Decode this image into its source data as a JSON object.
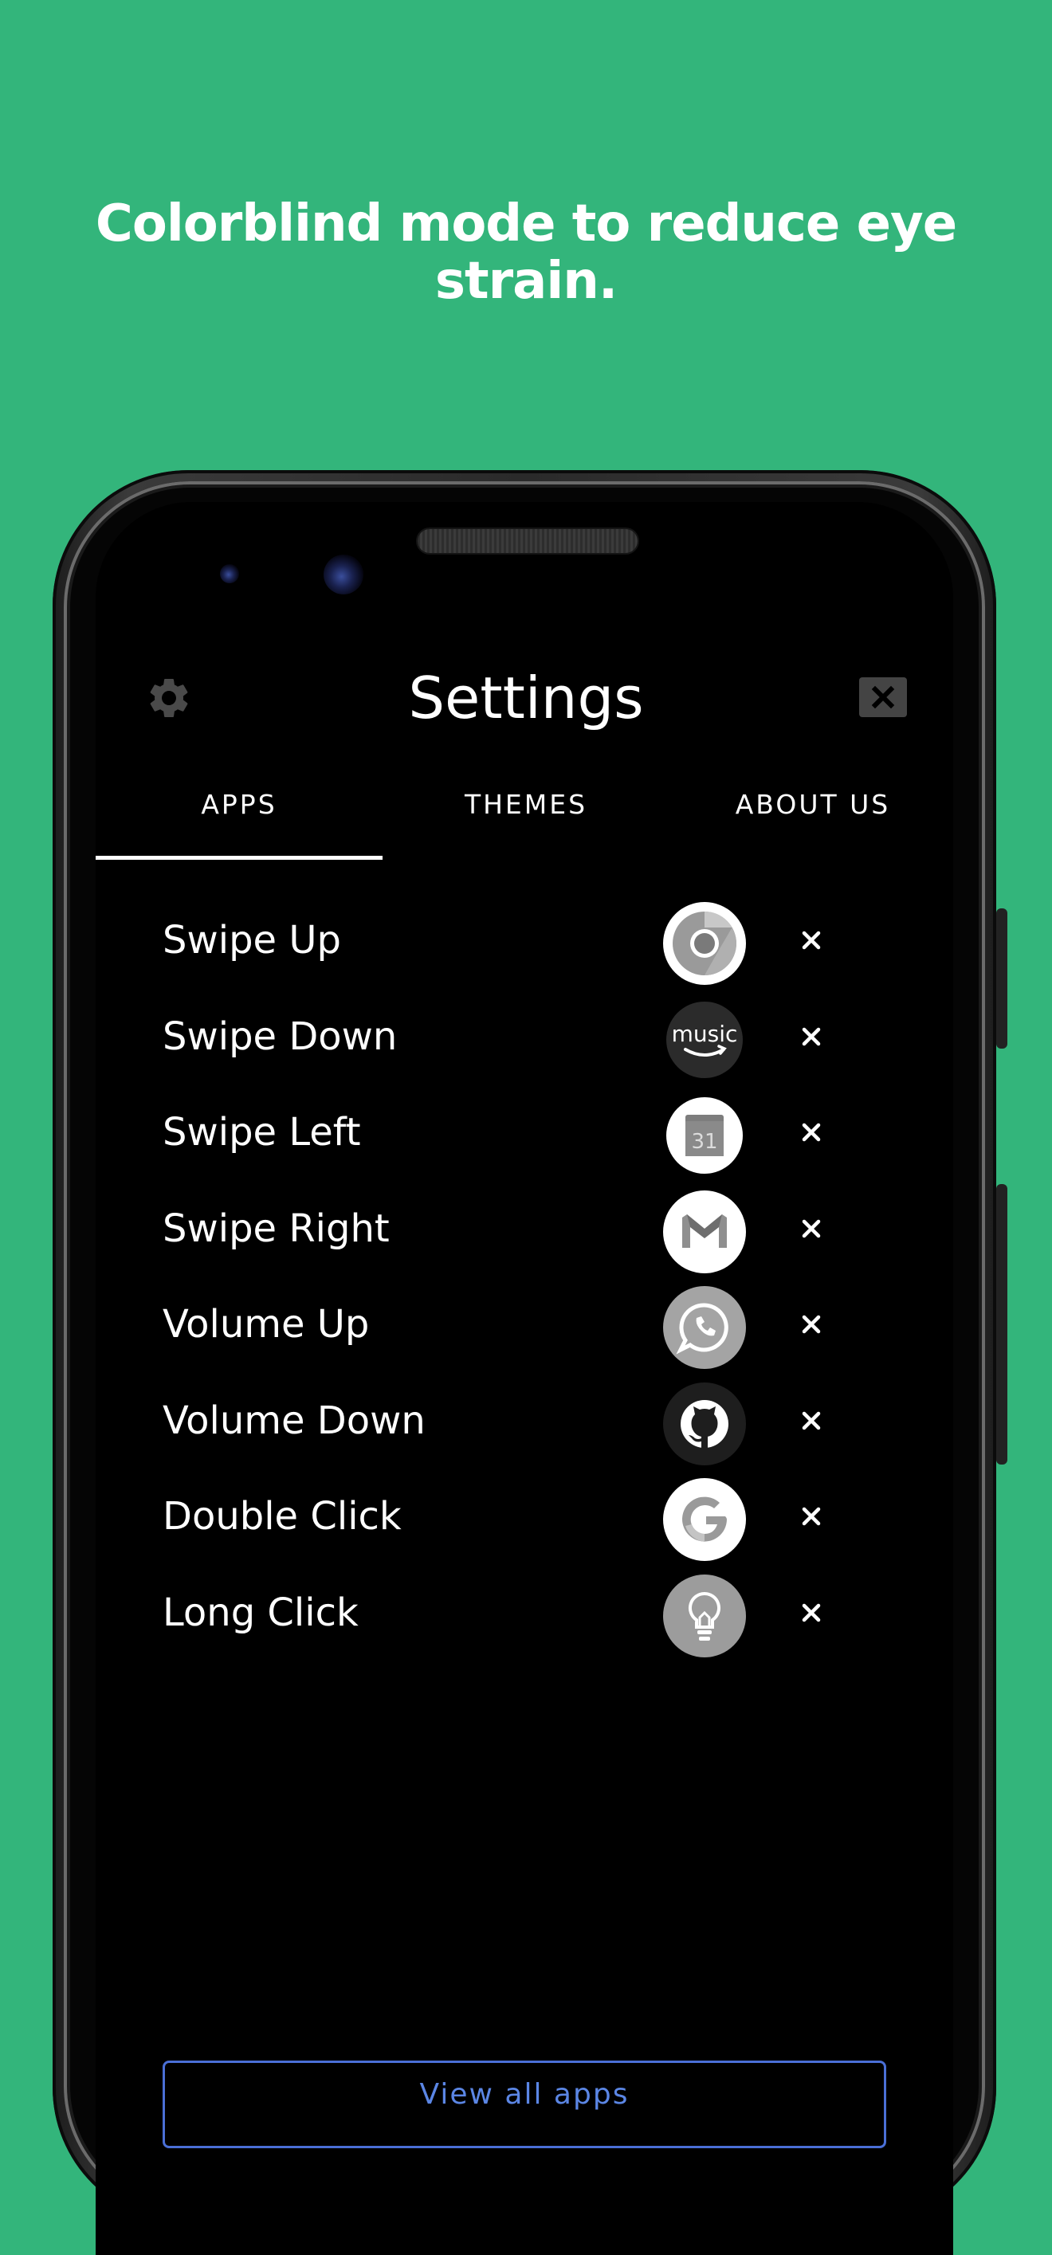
{
  "headline": "Colorblind mode to reduce eye strain.",
  "header": {
    "title": "Settings",
    "settings_icon": "gear-icon",
    "close_icon": "close-icon"
  },
  "tabs": [
    {
      "label": "APPS",
      "active": true
    },
    {
      "label": "THEMES",
      "active": false
    },
    {
      "label": "ABOUT US",
      "active": false
    }
  ],
  "gestures": [
    {
      "label": "Swipe Up",
      "app_icon": "chrome-icon"
    },
    {
      "label": "Swipe Down",
      "app_icon": "amazon-music-icon"
    },
    {
      "label": "Swipe Left",
      "app_icon": "calendar-icon"
    },
    {
      "label": "Swipe Right",
      "app_icon": "gmail-icon"
    },
    {
      "label": "Volume Up",
      "app_icon": "whatsapp-icon"
    },
    {
      "label": "Volume Down",
      "app_icon": "github-icon"
    },
    {
      "label": "Double Click",
      "app_icon": "google-icon"
    },
    {
      "label": "Long Click",
      "app_icon": "lightbulb-icon"
    }
  ],
  "icon_texts": {
    "music": "music",
    "calendar_day": "31"
  },
  "view_all_label": "View all apps",
  "colors": {
    "background": "#33b57b",
    "screen": "#000000",
    "accent": "#5b86e5",
    "text": "#ffffff"
  }
}
